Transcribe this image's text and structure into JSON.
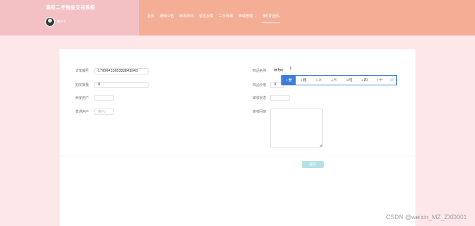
{
  "header": {
    "app_title": "高校二手物品交易系统",
    "username": "用户2",
    "user_caret": "·",
    "nav": [
      {
        "label": "首页"
      },
      {
        "label": "通知公告"
      },
      {
        "label": "新闻资讯"
      },
      {
        "label": "留言反馈"
      },
      {
        "label": "二手商城"
      },
      {
        "label": "商城管理",
        "caret": "⌄"
      },
      {
        "label": "我们的团队"
      }
    ],
    "colors": {
      "left": "#f3c1c4",
      "right": "#f4ae96",
      "active": "#ffffff"
    }
  },
  "form": {
    "order_no": {
      "label": "订单编号",
      "value": "1709641365332841943"
    },
    "product_name": {
      "label": "商品名称",
      "value": "商标s"
    },
    "buy_qty": {
      "label": "购买数量",
      "value": "0"
    },
    "product_price": {
      "label": "商品价格",
      "value": "0"
    },
    "seller_user": {
      "label": "卖家用户",
      "value": ""
    },
    "audit_status": {
      "label": "审核状态",
      "value": ""
    },
    "buyer_user": {
      "label": "普通用户",
      "placeholder": "用户2"
    },
    "audit_reply": {
      "label": "审核回复",
      "value": ""
    },
    "submit_label": "提交"
  },
  "ime": {
    "candidates": [
      {
        "num": "1",
        "text": "是"
      },
      {
        "num": "2",
        "text": "说"
      },
      {
        "num": "3",
        "text": "上"
      },
      {
        "num": "4",
        "text": "三"
      },
      {
        "num": "5",
        "text": "时"
      },
      {
        "num": "6",
        "text": "四"
      },
      {
        "num": "7",
        "text": "十"
      }
    ],
    "emoji_icon": "smiley-icon",
    "selected_index": 0,
    "accent": "#3b7dd8"
  },
  "watermark": "CSDN @weixin_MZ_ZXD001"
}
